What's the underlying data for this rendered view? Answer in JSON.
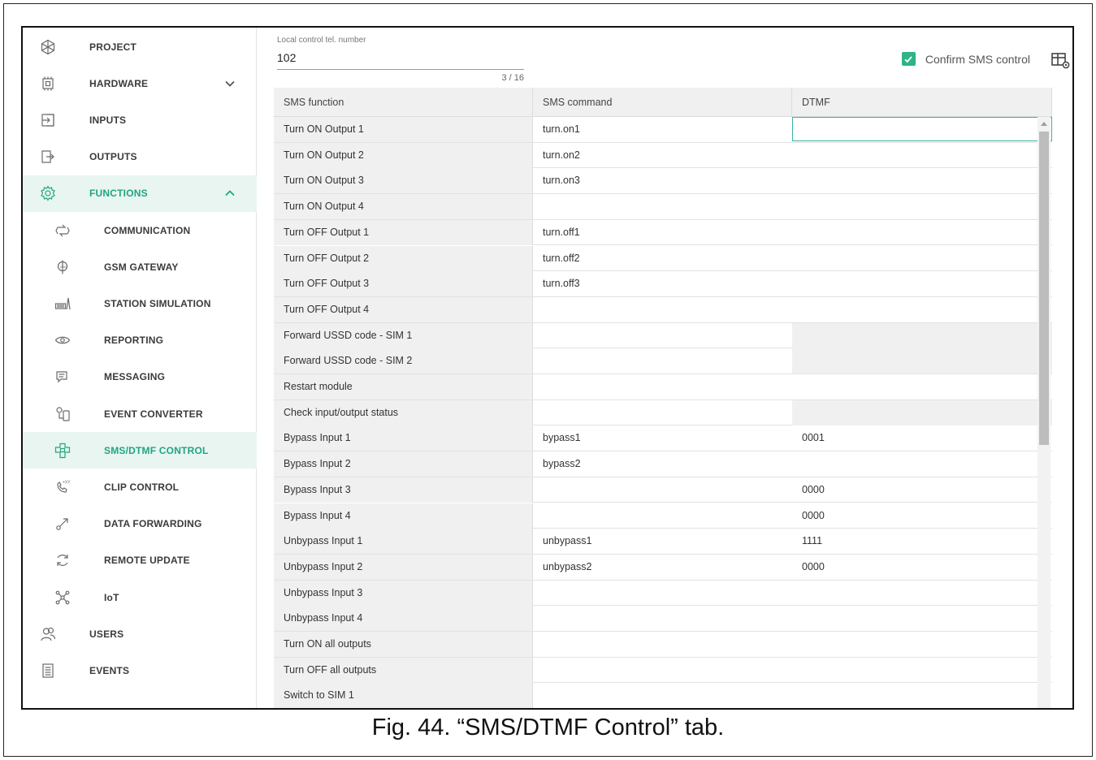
{
  "caption": "Fig. 44. “SMS/DTMF Control” tab.",
  "colors": {
    "accent": "#21a57f",
    "active_bg": "#e8f5f1",
    "selected_border": "#3ab2a6"
  },
  "sidebar": {
    "items": [
      {
        "label": "PROJECT",
        "icon": "project-icon",
        "level": "top"
      },
      {
        "label": "HARDWARE",
        "icon": "hardware-chip-icon",
        "level": "top",
        "chevron": "chevron-down-icon"
      },
      {
        "label": "INPUTS",
        "icon": "inputs-icon",
        "level": "top"
      },
      {
        "label": "OUTPUTS",
        "icon": "outputs-icon",
        "level": "top"
      },
      {
        "label": "FUNCTIONS",
        "icon": "gear-icon",
        "level": "top",
        "chevron": "chevron-up-icon",
        "expanded": true
      },
      {
        "label": "COMMUNICATION",
        "icon": "communication-icon",
        "level": "sub"
      },
      {
        "label": "GSM GATEWAY",
        "icon": "gsm-gateway-icon",
        "level": "sub"
      },
      {
        "label": "STATION SIMULATION",
        "icon": "station-simulation-icon",
        "level": "sub"
      },
      {
        "label": "REPORTING",
        "icon": "eye-icon",
        "level": "sub"
      },
      {
        "label": "MESSAGING",
        "icon": "message-icon",
        "level": "sub"
      },
      {
        "label": "EVENT CONVERTER",
        "icon": "event-converter-icon",
        "level": "sub"
      },
      {
        "label": "SMS/DTMF CONTROL",
        "icon": "sms-dtmf-control-icon",
        "level": "sub",
        "active": true
      },
      {
        "label": "CLIP CONTROL",
        "icon": "clip-control-icon",
        "level": "sub"
      },
      {
        "label": "DATA FORWARDING",
        "icon": "data-forwarding-icon",
        "level": "sub"
      },
      {
        "label": "REMOTE UPDATE",
        "icon": "remote-update-icon",
        "level": "sub"
      },
      {
        "label": "IoT",
        "icon": "iot-icon",
        "level": "sub"
      },
      {
        "label": "USERS",
        "icon": "users-icon",
        "level": "top"
      },
      {
        "label": "EVENTS",
        "icon": "events-icon",
        "level": "top"
      }
    ]
  },
  "local_control": {
    "label": "Local control tel. number",
    "value": "102",
    "counter": "3 / 16"
  },
  "confirm_sms": {
    "label": "Confirm SMS control",
    "checked": true
  },
  "table": {
    "headers": [
      "SMS function",
      "SMS command",
      "DTMF"
    ],
    "rows": [
      {
        "function": "Turn ON Output 1",
        "command": "turn.on1",
        "dtmf": "",
        "dtmf_selected": true
      },
      {
        "function": "Turn ON Output 2",
        "command": "turn.on2",
        "dtmf": ""
      },
      {
        "function": "Turn ON Output 3",
        "command": "turn.on3",
        "dtmf": ""
      },
      {
        "function": "Turn ON Output 4",
        "command": "",
        "dtmf": ""
      },
      {
        "function": "Turn OFF Output 1",
        "command": "turn.off1",
        "dtmf": ""
      },
      {
        "function": "Turn OFF Output 2",
        "command": "turn.off2",
        "dtmf": ""
      },
      {
        "function": "Turn OFF Output 3",
        "command": "turn.off3",
        "dtmf": ""
      },
      {
        "function": "Turn OFF Output 4",
        "command": "",
        "dtmf": ""
      },
      {
        "function": "Forward USSD code - SIM 1",
        "command": "",
        "dtmf": "",
        "dtmf_disabled": true
      },
      {
        "function": "Forward USSD code - SIM 2",
        "command": "",
        "dtmf": "",
        "dtmf_disabled": true
      },
      {
        "function": "Restart module",
        "command": "",
        "dtmf": ""
      },
      {
        "function": "Check input/output status",
        "command": "",
        "dtmf": "",
        "dtmf_disabled": true
      },
      {
        "function": "Bypass Input 1",
        "command": "bypass1",
        "dtmf": "0001"
      },
      {
        "function": "Bypass Input 2",
        "command": "bypass2",
        "dtmf": ""
      },
      {
        "function": "Bypass Input 3",
        "command": "",
        "dtmf": "0000"
      },
      {
        "function": "Bypass Input 4",
        "command": "",
        "dtmf": "0000"
      },
      {
        "function": "Unbypass Input 1",
        "command": "unbypass1",
        "dtmf": "1111"
      },
      {
        "function": "Unbypass Input 2",
        "command": "unbypass2",
        "dtmf": "0000"
      },
      {
        "function": "Unbypass Input 3",
        "command": "",
        "dtmf": ""
      },
      {
        "function": "Unbypass Input 4",
        "command": "",
        "dtmf": ""
      },
      {
        "function": "Turn ON all outputs",
        "command": "",
        "dtmf": ""
      },
      {
        "function": "Turn OFF all outputs",
        "command": "",
        "dtmf": ""
      },
      {
        "function": "Switch to SIM 1",
        "command": "",
        "dtmf": ""
      }
    ]
  }
}
